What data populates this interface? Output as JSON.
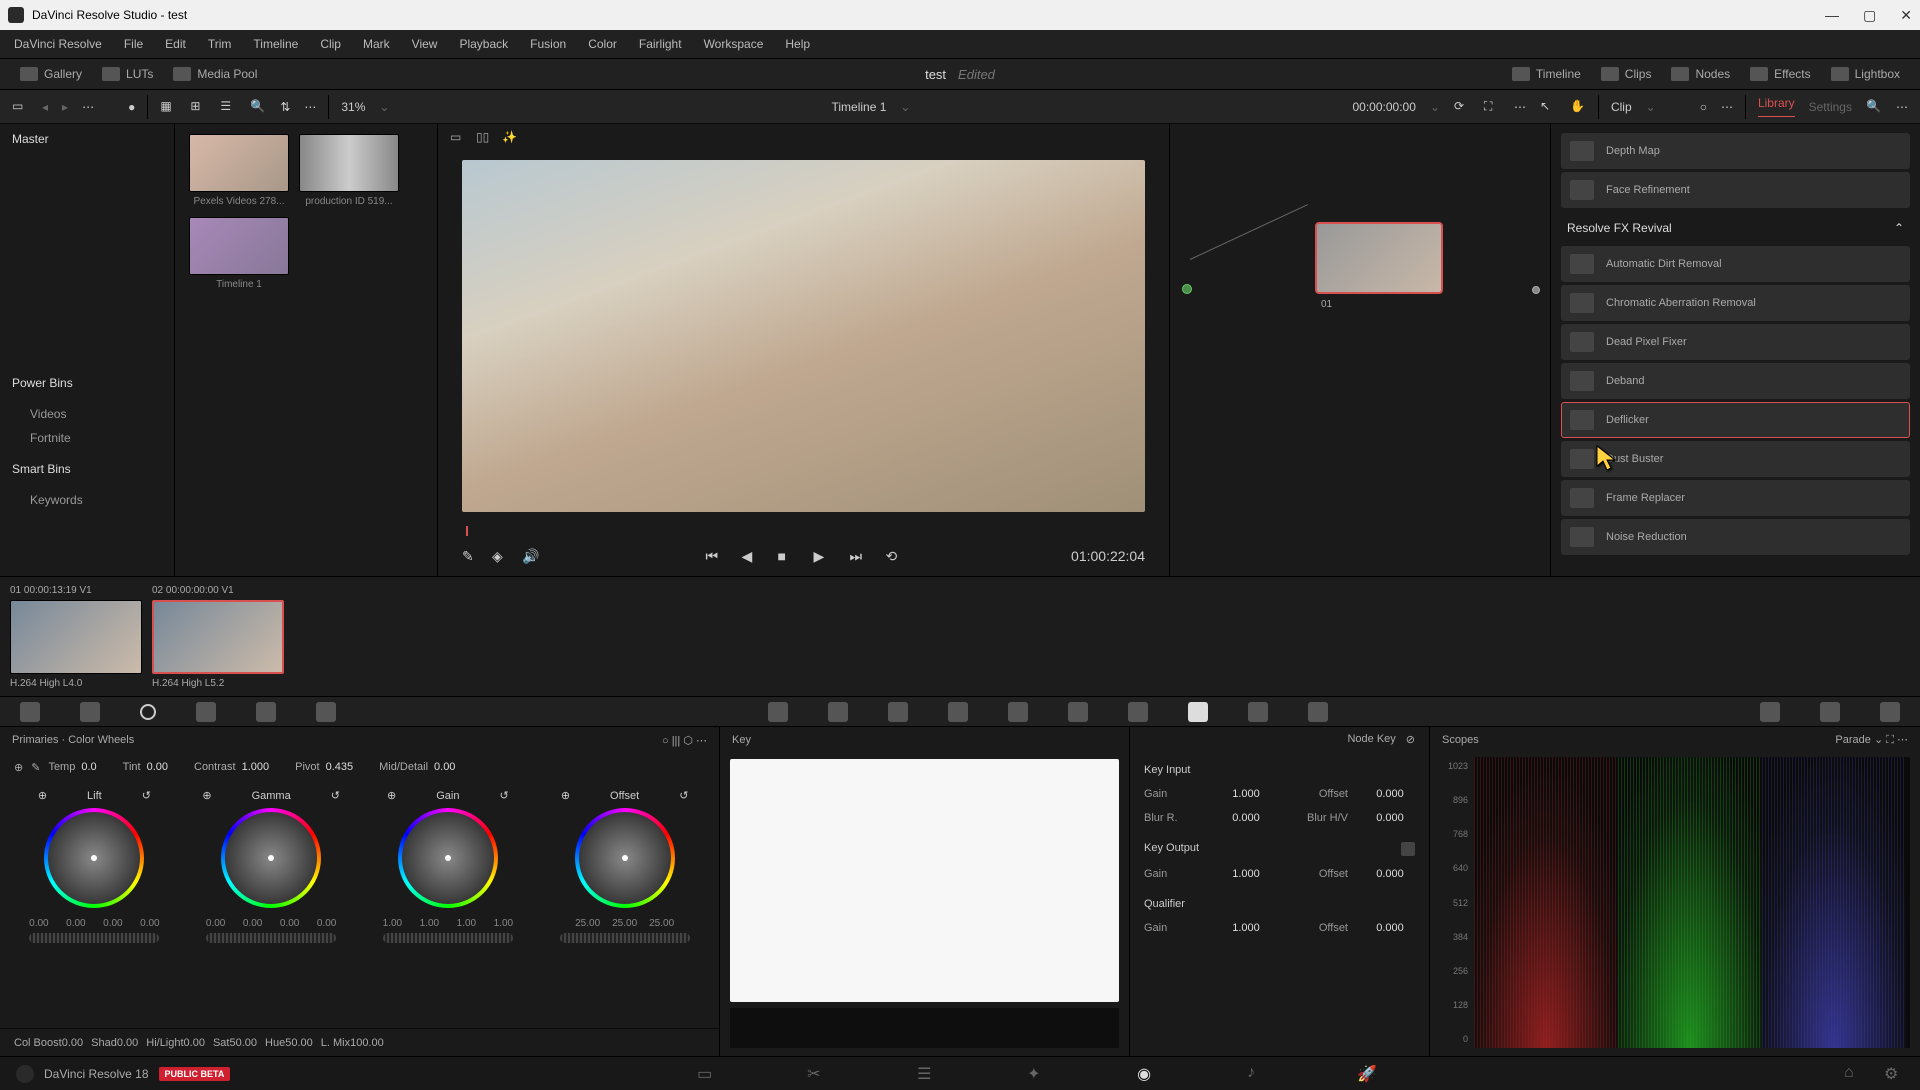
{
  "title": "DaVinci Resolve Studio - test",
  "menu": [
    "DaVinci Resolve",
    "File",
    "Edit",
    "Trim",
    "Timeline",
    "Clip",
    "Mark",
    "View",
    "Playback",
    "Fusion",
    "Color",
    "Fairlight",
    "Workspace",
    "Help"
  ],
  "toolbar": {
    "gallery": "Gallery",
    "luts": "LUTs",
    "mediapool": "Media Pool",
    "project": "test",
    "status": "Edited",
    "timeline": "Timeline",
    "clips": "Clips",
    "nodes": "Nodes",
    "effects": "Effects",
    "lightbox": "Lightbox"
  },
  "row2": {
    "zoom": "31%",
    "tlname": "Timeline 1",
    "tc": "00:00:00:00",
    "clip": "Clip",
    "library": "Library",
    "settings": "Settings"
  },
  "browser": {
    "master": "Master",
    "powerbins": "Power Bins",
    "bins": [
      "Videos",
      "Fortnite"
    ],
    "smartbins": "Smart Bins",
    "sbins": [
      "Keywords"
    ]
  },
  "thumbs": [
    {
      "label": "Pexels Videos 278..."
    },
    {
      "label": "production ID 519..."
    },
    {
      "label": "Timeline 1"
    }
  ],
  "nodes": {
    "num": "01"
  },
  "transport": {
    "tc": "01:00:22:04"
  },
  "fx": {
    "top": [
      "Depth Map",
      "Face Refinement"
    ],
    "cat": "Resolve FX Revival",
    "items": [
      "Automatic Dirt Removal",
      "Chromatic Aberration Removal",
      "Dead Pixel Fixer",
      "Deband",
      "Deflicker",
      "Dust Buster",
      "Frame Replacer",
      "Noise Reduction"
    ],
    "selected": 4
  },
  "clips": [
    {
      "meta": "01   00:00:13:19   V1",
      "name": "H.264 High L4.0",
      "sel": false
    },
    {
      "meta": "02   00:00:00:00   V1",
      "name": "H.264 High L5.2",
      "sel": true
    }
  ],
  "primaries": {
    "title": "Primaries · Color Wheels",
    "row1": [
      [
        "Temp",
        "0.0"
      ],
      [
        "Tint",
        "0.00"
      ],
      [
        "Contrast",
        "1.000"
      ],
      [
        "Pivot",
        "0.435"
      ],
      [
        "Mid/Detail",
        "0.00"
      ]
    ],
    "wheels": [
      {
        "name": "Lift",
        "vals": [
          "0.00",
          "0.00",
          "0.00",
          "0.00"
        ]
      },
      {
        "name": "Gamma",
        "vals": [
          "0.00",
          "0.00",
          "0.00",
          "0.00"
        ]
      },
      {
        "name": "Gain",
        "vals": [
          "1.00",
          "1.00",
          "1.00",
          "1.00"
        ]
      },
      {
        "name": "Offset",
        "vals": [
          "25.00",
          "25.00",
          "25.00"
        ]
      }
    ],
    "row2": [
      [
        "Col Boost",
        "0.00"
      ],
      [
        "Shad",
        "0.00"
      ],
      [
        "Hi/Light",
        "0.00"
      ],
      [
        "Sat",
        "50.00"
      ],
      [
        "Hue",
        "50.00"
      ],
      [
        "L. Mix",
        "100.00"
      ]
    ]
  },
  "key": {
    "title": "Key",
    "nodekey": "Node Key",
    "input": "Key Input",
    "output": "Key Output",
    "qualifier": "Qualifier",
    "rows": [
      [
        "Gain",
        "1.000",
        "Offset",
        "0.000"
      ],
      [
        "Blur R.",
        "0.000",
        "Blur H/V",
        "0.000"
      ],
      [
        "Gain",
        "1.000",
        "Offset",
        "0.000"
      ],
      [
        "Gain",
        "1.000",
        "Offset",
        "0.000"
      ]
    ]
  },
  "scopes": {
    "title": "Scopes",
    "mode": "Parade",
    "axis": [
      "1023",
      "896",
      "768",
      "640",
      "512",
      "384",
      "256",
      "128",
      "0"
    ]
  },
  "footer": {
    "app": "DaVinci Resolve 18",
    "beta": "PUBLIC BETA"
  }
}
